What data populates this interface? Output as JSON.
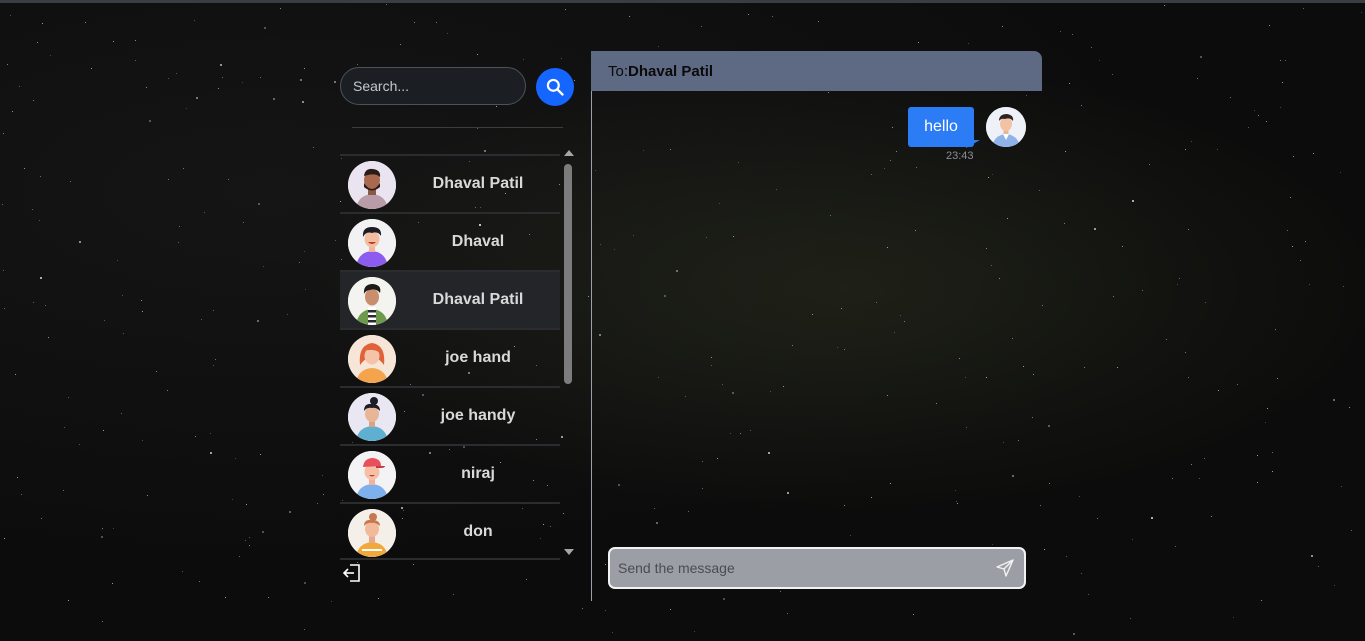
{
  "sidebar": {
    "search_placeholder": "Search...",
    "contacts": [
      {
        "name": "Dhaval Patil",
        "avatar": "avatar-bearded-man",
        "active": false
      },
      {
        "name": "Dhaval",
        "avatar": "avatar-purple-shirt",
        "active": false
      },
      {
        "name": "Dhaval Patil",
        "avatar": "avatar-striped-shirt",
        "active": true
      },
      {
        "name": "joe hand",
        "avatar": "avatar-redhead-woman",
        "active": false
      },
      {
        "name": "joe handy",
        "avatar": "avatar-bun-hair",
        "active": false
      },
      {
        "name": "niraj",
        "avatar": "avatar-red-cap",
        "active": false
      },
      {
        "name": "don",
        "avatar": "avatar-orange-shirt",
        "active": false
      }
    ]
  },
  "chat": {
    "to_label": "To:",
    "recipient": "Dhaval Patil",
    "messages": [
      {
        "text": "hello",
        "time": "23:43"
      }
    ],
    "composer_placeholder": "Send the message"
  },
  "colors": {
    "accent": "#1565ff",
    "bubble": "#2b7cf5",
    "header": "#5e6a84",
    "composer": "#9c9ea6"
  },
  "icons": [
    "search-icon",
    "logout-icon",
    "send-icon",
    "scroll-up-arrow",
    "scroll-down-arrow"
  ]
}
